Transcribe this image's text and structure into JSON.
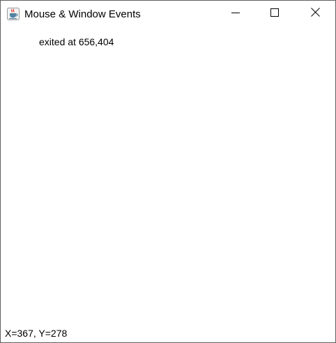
{
  "window": {
    "title": "Mouse & Window Events",
    "app_icon": "java-coffee-cup-icon",
    "controls": {
      "minimize_icon": "minimize-icon",
      "maximize_icon": "maximize-icon",
      "close_icon": "close-icon"
    }
  },
  "content": {
    "event_message": "exited at 656,404",
    "coordinates": "X=367, Y=278"
  }
}
